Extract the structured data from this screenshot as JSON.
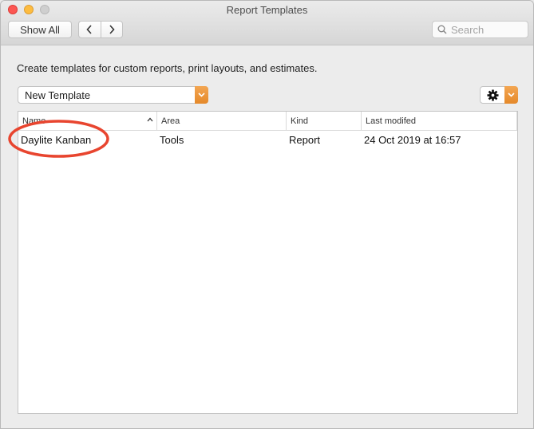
{
  "window": {
    "title": "Report Templates"
  },
  "toolbar": {
    "show_all_label": "Show All",
    "back_icon": "chevron-left-icon",
    "forward_icon": "chevron-right-icon",
    "search_placeholder": "Search"
  },
  "main": {
    "description": "Create templates for custom reports, print layouts, and estimates.",
    "template_popup": {
      "selected": "New Template"
    },
    "action_menu": {
      "icon": "gear-icon"
    }
  },
  "table": {
    "columns": [
      {
        "label": "Name"
      },
      {
        "label": "Area"
      },
      {
        "label": "Kind"
      },
      {
        "label": "Last modifed"
      }
    ],
    "sort": {
      "column": "Name",
      "direction": "ascending"
    },
    "rows": [
      {
        "name": "Daylite Kanban",
        "area": "Tools",
        "kind": "Report",
        "modified": "24 Oct 2019 at 16:57"
      }
    ]
  },
  "annotation": {
    "ring_color": "#e8452f"
  }
}
